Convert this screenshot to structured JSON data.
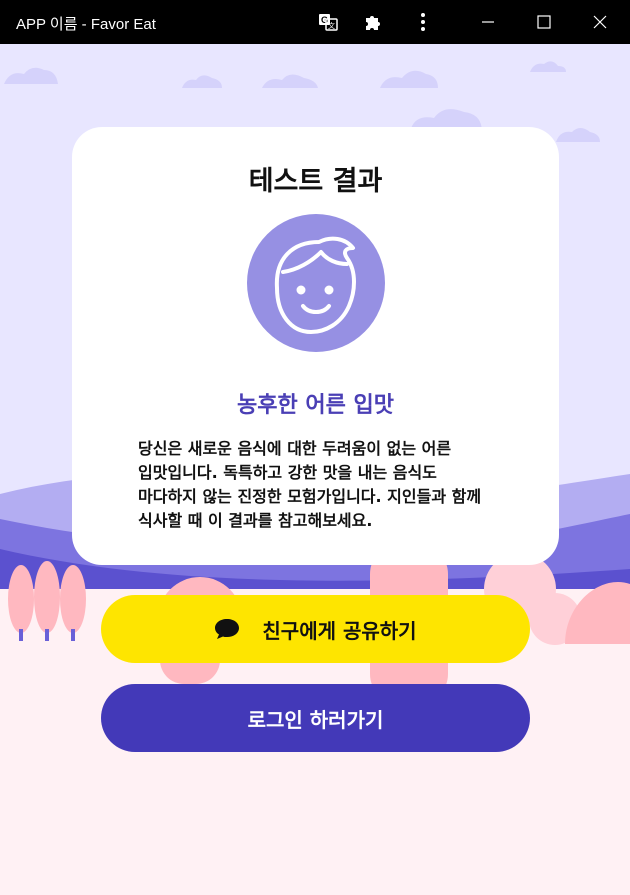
{
  "window": {
    "title": "APP 이름 - Favor Eat",
    "icons": [
      "translate-icon",
      "extension-puzzle-icon",
      "more-vert-icon",
      "minimize-icon",
      "maximize-icon",
      "close-icon"
    ]
  },
  "card": {
    "title": "테스트 결과",
    "avatar_icon": "smiling-face-icon",
    "result_name": "농후한 어른 입맛",
    "result_desc": "당신은 새로운 음식에 대한 두려움이 없는 어른 입맛입니다. 독특하고 강한 맛을 내는 음식도 마다하지 않는 진정한 모험가입니다. 지인들과 함께 식사할 때 이 결과를 참고해보세요."
  },
  "buttons": {
    "share_label": "친구에게 공유하기",
    "share_icon": "chat-bubble-icon",
    "login_label": "로그인 하러가기"
  },
  "colors": {
    "accent": "#4a3fb5",
    "kakao_yellow": "#fee500",
    "login_button": "#4339b8",
    "sky": "#e8e6ff",
    "avatar_bg": "#9690e3"
  }
}
